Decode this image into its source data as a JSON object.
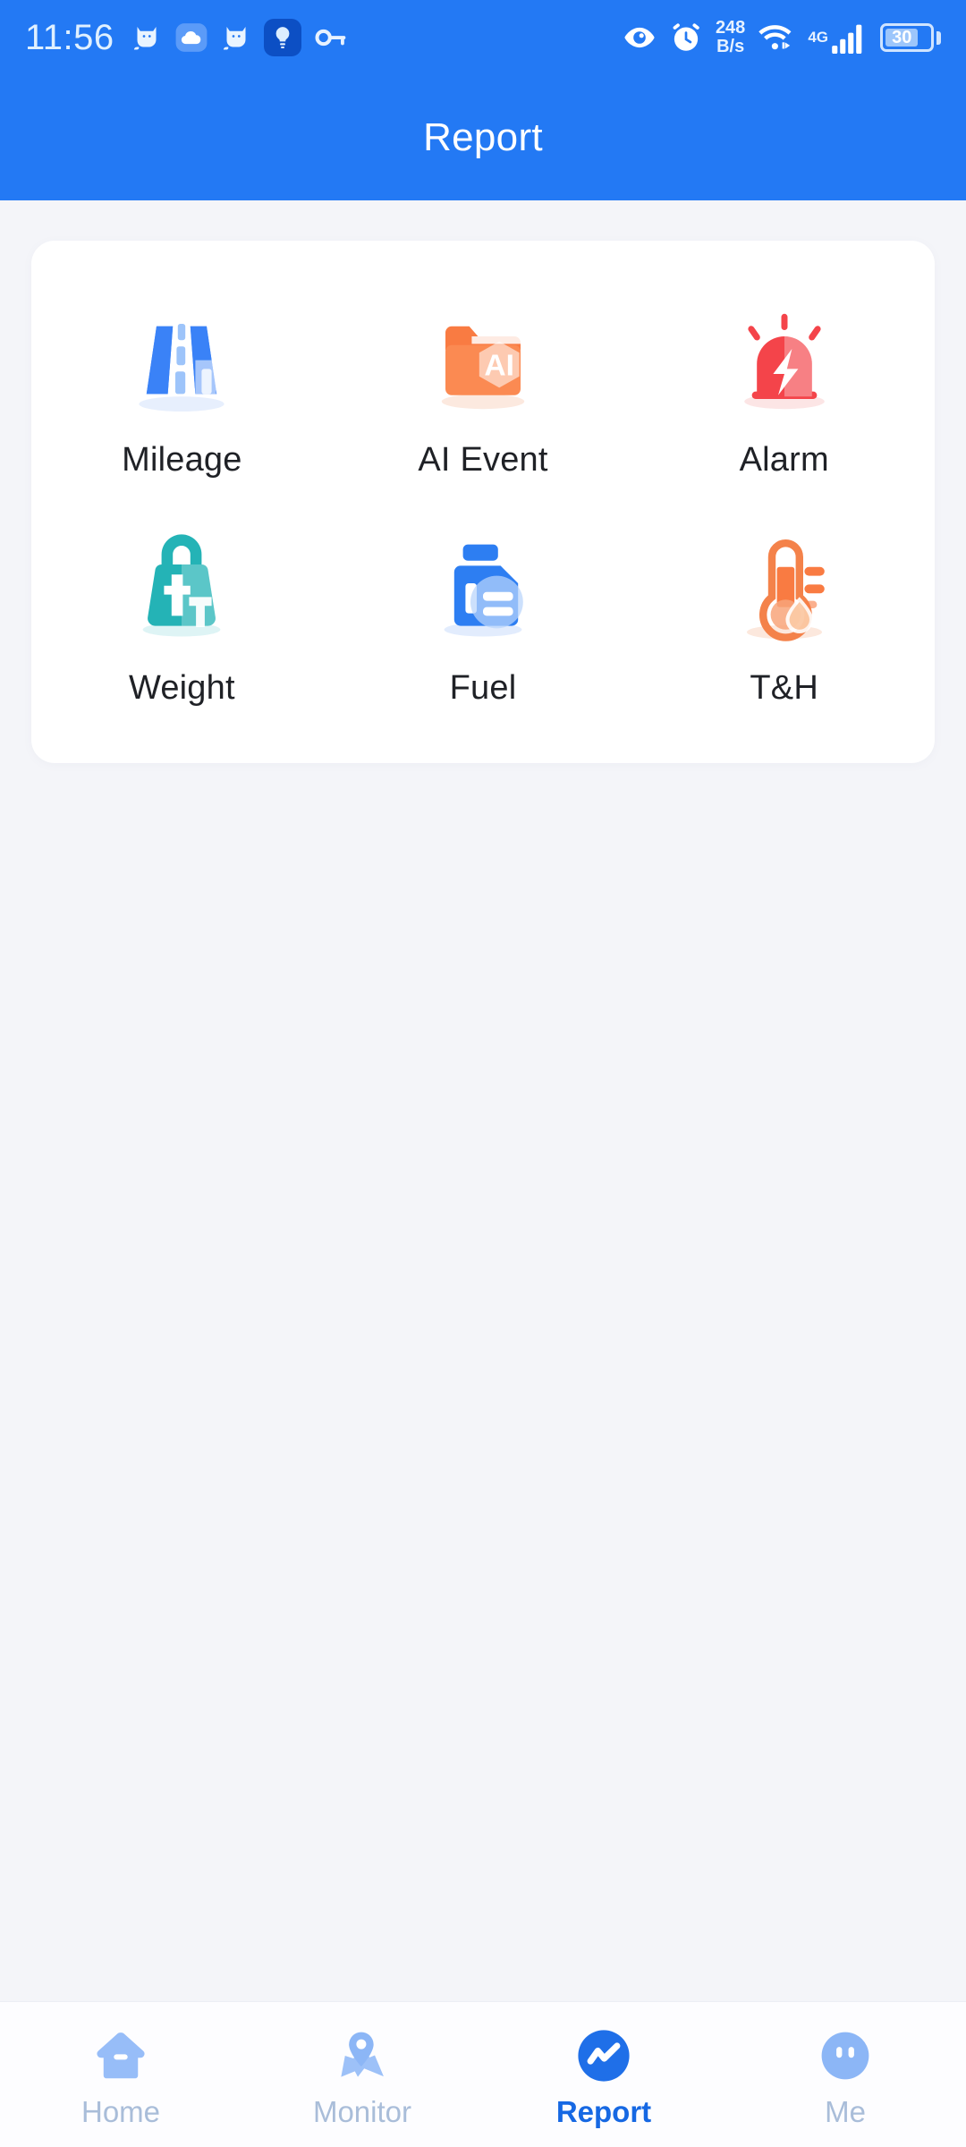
{
  "statusbar": {
    "time": "11:56",
    "network_speed_value": "248",
    "network_speed_unit": "B/s",
    "mobile_network": "4G",
    "battery_level": "30",
    "left_icons": [
      "cat-icon",
      "cloud-icon",
      "cat-icon",
      "lightbulb-icon",
      "key-icon"
    ],
    "right_icons": [
      "eye-icon",
      "alarm-clock-icon",
      "network-speed",
      "wifi-icon",
      "cellular-signal-icon",
      "battery-icon"
    ]
  },
  "header": {
    "title": "Report"
  },
  "report_grid": {
    "rows": [
      [
        {
          "label": "Mileage",
          "icon": "road-icon",
          "color": "#3a82f7"
        },
        {
          "label": "AI Event",
          "icon": "ai-folder-icon",
          "color": "#f97b42"
        },
        {
          "label": "Alarm",
          "icon": "siren-icon",
          "color": "#f4444a"
        }
      ],
      [
        {
          "label": "Weight",
          "icon": "weight-icon",
          "color": "#24b3b6"
        },
        {
          "label": "Fuel",
          "icon": "fuel-can-icon",
          "color": "#2d7ef2"
        },
        {
          "label": "T&H",
          "icon": "thermometer-icon",
          "color": "#f4824a"
        }
      ]
    ]
  },
  "bottom_nav": {
    "items": [
      {
        "label": "Home",
        "icon": "home-icon",
        "active": false
      },
      {
        "label": "Monitor",
        "icon": "map-pin-icon",
        "active": false
      },
      {
        "label": "Report",
        "icon": "chart-line-icon",
        "active": true
      },
      {
        "label": "Me",
        "icon": "profile-icon",
        "active": false
      }
    ]
  },
  "colors": {
    "brand_blue": "#2379f4",
    "page_background": "#f4f5f9",
    "card_background": "#ffffff",
    "active_nav": "#1668e3",
    "inactive_nav": "#a9bdd9"
  }
}
